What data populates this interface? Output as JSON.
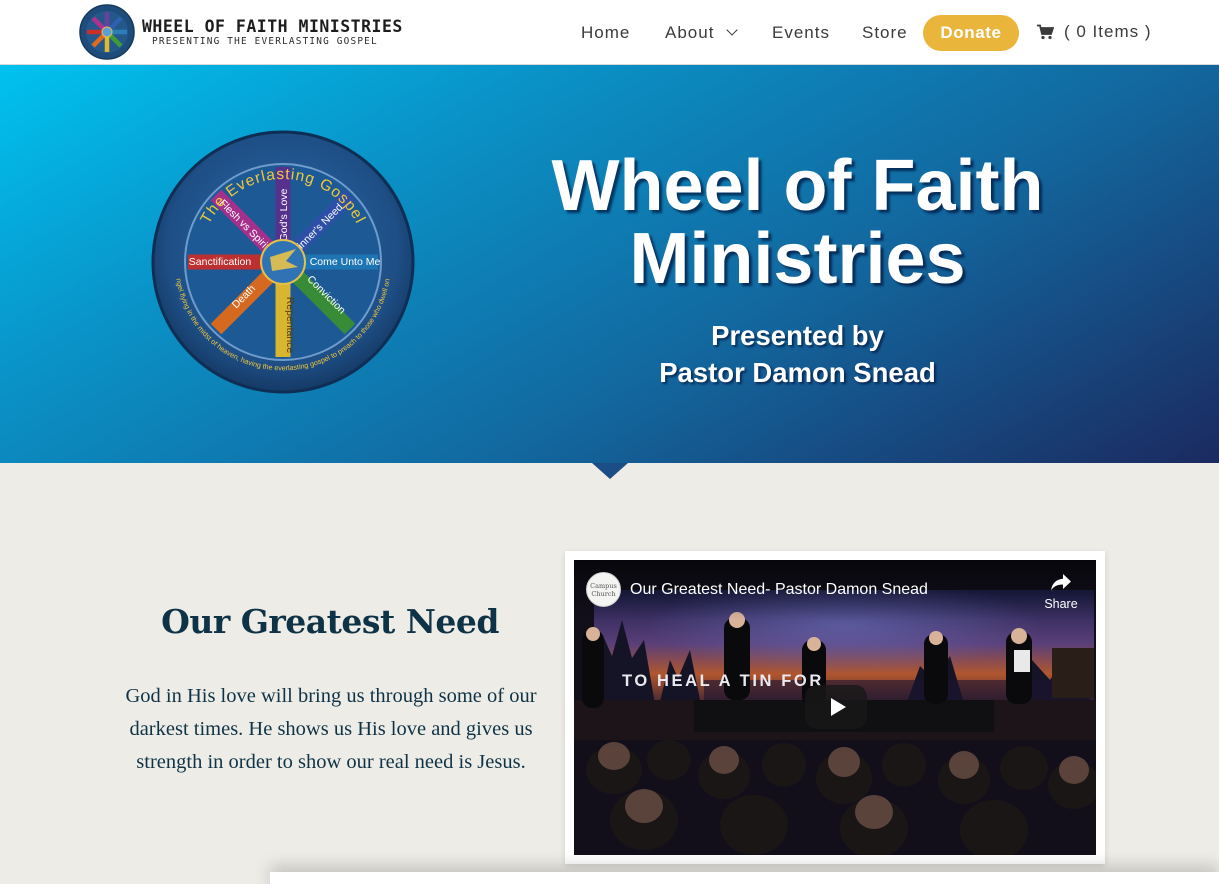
{
  "header": {
    "logo": {
      "title": "WHEEL OF FAITH MINISTRIES",
      "tagline": "PRESENTING THE EVERLASTING GOSPEL"
    },
    "nav": [
      {
        "label": "Home"
      },
      {
        "label": "About"
      },
      {
        "label": "Events"
      },
      {
        "label": "Store"
      }
    ],
    "donate_label": "Donate",
    "cart_label": "( 0 Items )",
    "cart_icon": "shopping-cart-icon"
  },
  "hero": {
    "title_line1": "Wheel of Faith",
    "title_line2": "Ministries",
    "subtitle_line1": "Presented by",
    "subtitle_line2": "Pastor Damon Snead",
    "wheel": {
      "rim_text": "The Everlasting Gospel",
      "spokes": [
        "God's Love",
        "Sinner's Need",
        "Come Unto Me",
        "Conviction",
        "Repentance",
        "Death",
        "Sanctification",
        "Flesh vs Spirit"
      ],
      "verse": "Then I saw another angel flying in the midst of heaven, having the everlasting gospel to preach to those who dwell on the earth -- Rev 14:6"
    },
    "colors": {
      "gradient_start": "#00c2ef",
      "gradient_end": "#1b2a60"
    }
  },
  "content": {
    "section_title": "Our Greatest Need",
    "body_line1": "God in His love will bring us through some of our",
    "body_line2": "darkest times. He shows us His love and gives us",
    "body_line3": "strength in order to show our real need is Jesus."
  },
  "video": {
    "title": "Our Greatest Need- Pastor Damon Snead",
    "channel_avatar_text": "Campus Church",
    "share_label": "Share",
    "banner_text": "TO HEAL A   TIN  FOR",
    "play_icon": "play-icon"
  },
  "colors": {
    "accent": "#e9b53b",
    "heading": "#0f3346",
    "background": "#eeece6"
  }
}
